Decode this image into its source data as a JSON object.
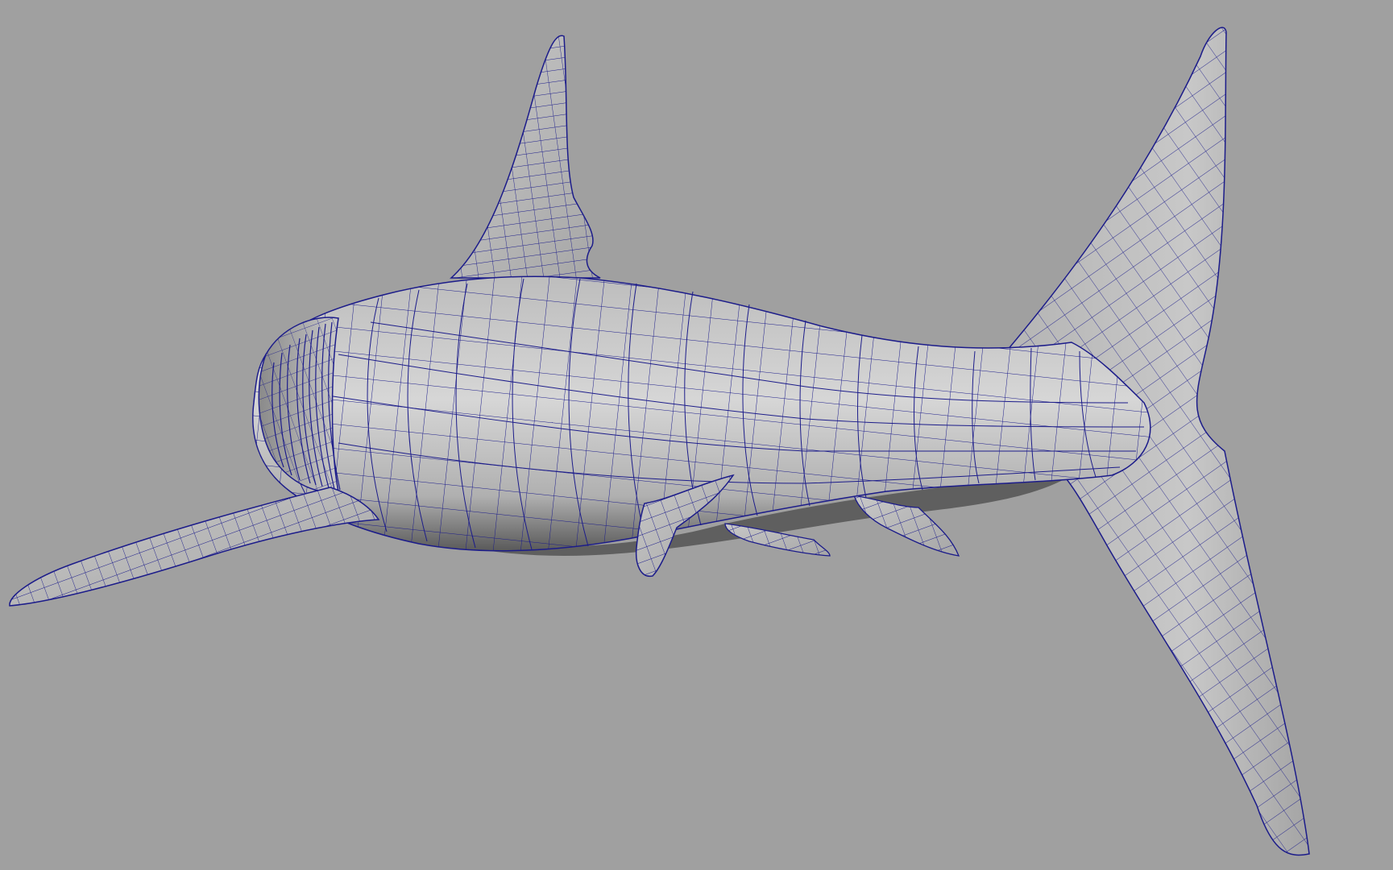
{
  "viewport": {
    "background_color": "#a0a0a0",
    "display_mode": "wireframe-on-shaded",
    "wire_color": "#1c1c8a",
    "shade_light": "#d4d4d4",
    "shade_mid": "#a8a8a8",
    "shade_dark": "#4a4a4a"
  },
  "model": {
    "subject": "shark",
    "parts": [
      "body",
      "dorsal-fin",
      "caudal-fin",
      "pectoral-fin",
      "pelvic-fin",
      "anal-fin",
      "second-dorsal-fin",
      "head"
    ]
  }
}
